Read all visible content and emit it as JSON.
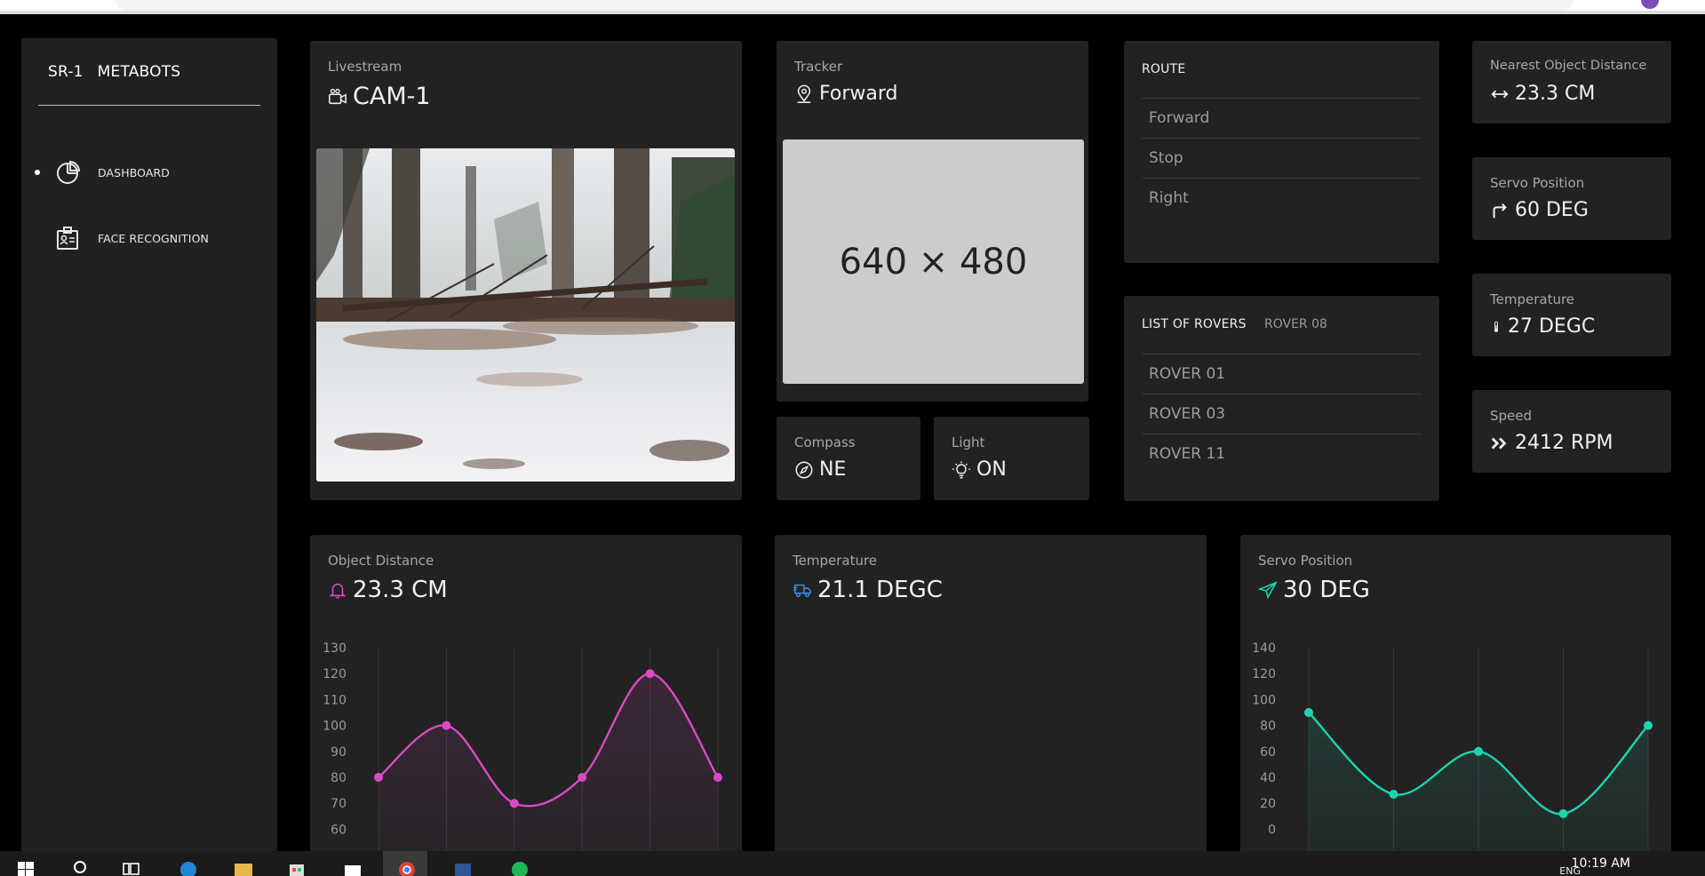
{
  "colors": {
    "background": "#000000",
    "panel": "#222222",
    "text": "#e6e6e6",
    "muted": "#a7a7a7",
    "pink_accent": "#d84bc4",
    "teal_accent": "#1ed4b0",
    "blue_accent": "#3b8ee0"
  },
  "sidebar": {
    "brand_code": "SR-1",
    "brand_name": "METABOTS",
    "items": [
      {
        "label": "DASHBOARD",
        "icon": "pie-chart-icon",
        "active": true
      },
      {
        "label": "FACE RECOGNITION",
        "icon": "id-badge-icon",
        "active": false
      }
    ]
  },
  "livestream": {
    "label": "Livestream",
    "value": "CAM-1",
    "icon": "video-camera-icon"
  },
  "tracker": {
    "label": "Tracker",
    "value": "Forward",
    "icon": "map-pin-icon",
    "placeholder": "640 × 480"
  },
  "compass": {
    "label": "Compass",
    "value": "NE",
    "icon": "compass-icon"
  },
  "light": {
    "label": "Light",
    "value": "ON",
    "icon": "light-bulb-icon"
  },
  "route": {
    "title": "ROUTE",
    "items": [
      "Forward",
      "Stop",
      "Right"
    ]
  },
  "rovers": {
    "title": "LIST OF ROVERS",
    "selected": "ROVER 08",
    "items": [
      "ROVER 01",
      "ROVER 03",
      "ROVER 11"
    ]
  },
  "stats": [
    {
      "label": "Nearest Object Distance",
      "value": "23.3 CM",
      "icon": "double-arrow-icon"
    },
    {
      "label": "Servo Position",
      "value": "60 DEG",
      "icon": "turn-right-arrow-icon"
    },
    {
      "label": "Temperature",
      "value": "27 DEGC",
      "icon": "thermometer-icon"
    },
    {
      "label": "Speed",
      "value": "2412 RPM",
      "icon": "fast-forward-icon"
    }
  ],
  "object_distance": {
    "label": "Object Distance",
    "value": "23.3 CM",
    "icon": "bell-icon"
  },
  "temperature_chart": {
    "label": "Temperature",
    "value": "21.1 DEGC",
    "icon": "delivery-truck-icon"
  },
  "servo_chart": {
    "label": "Servo Position",
    "value": "30 DEG",
    "icon": "paper-plane-icon"
  },
  "chart_data": [
    {
      "type": "area",
      "title": "",
      "ylim": [
        55,
        130
      ],
      "yticks": [
        130,
        120,
        110,
        100,
        90,
        80,
        70,
        60
      ],
      "x": [
        1,
        2,
        3,
        4,
        5,
        6
      ],
      "values": [
        80,
        100,
        70,
        80,
        120,
        80
      ],
      "grid": true,
      "color": "#d84bc4"
    },
    {
      "type": "area",
      "title": "",
      "ylim": [
        -10,
        140
      ],
      "yticks": [
        140,
        120,
        100,
        80,
        60,
        40,
        20,
        0
      ],
      "x": [
        1,
        2,
        3,
        4,
        5
      ],
      "values": [
        90,
        27,
        60,
        12,
        80
      ],
      "grid": true,
      "color": "#1ed4b0"
    }
  ],
  "taskbar": {
    "time": "10:19 AM",
    "language": "ENG"
  }
}
